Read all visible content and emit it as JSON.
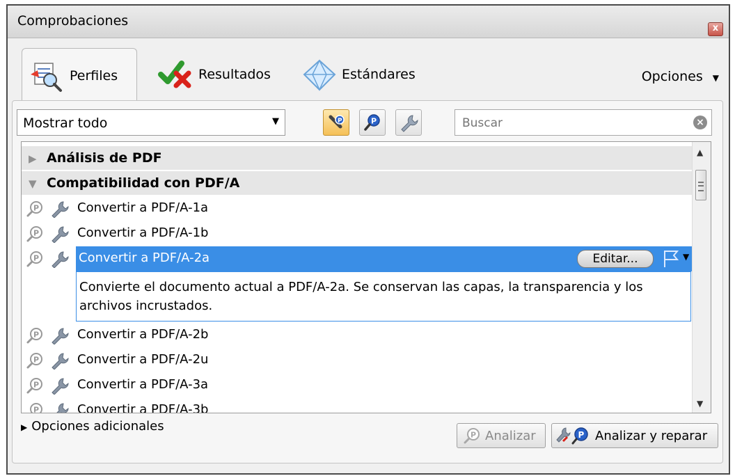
{
  "window": {
    "title": "Comprobaciones",
    "close_symbol": "x"
  },
  "tabs": [
    {
      "label": "Perfiles",
      "active": true,
      "icon": "profiles-icon"
    },
    {
      "label": "Resultados",
      "active": false,
      "icon": "results-icon"
    },
    {
      "label": "Estándares",
      "active": false,
      "icon": "standards-icon"
    }
  ],
  "options_menu": {
    "label": "Opciones",
    "arrow": "▼"
  },
  "filter": {
    "selected": "Mostrar todo",
    "arrow": "▼"
  },
  "toolbar_buttons": [
    "show-all-types-icon",
    "analyze-profile-icon",
    "fixup-icon"
  ],
  "search": {
    "placeholder": "Buscar",
    "clear_symbol": "×"
  },
  "groups": [
    {
      "label": "Análisis de PDF",
      "expanded": false,
      "tri": "▶"
    },
    {
      "label": "Compatibilidad con PDF/A",
      "expanded": true,
      "tri": "▼"
    }
  ],
  "items": [
    "Convertir a PDF/A-1a",
    "Convertir a PDF/A-1b",
    "Convertir a PDF/A-2a",
    "Convertir a PDF/A-2b",
    "Convertir a PDF/A-2u",
    "Convertir a PDF/A-3a",
    "Convertir a PDF/A-3b"
  ],
  "selected_item": {
    "label": "Convertir a PDF/A-2a",
    "edit_label": "Editar...",
    "description": "Convierte el documento actual a PDF/A-2a. Se conservan las capas, la transparencia y los archivos incrustados."
  },
  "footer": {
    "more_options": "Opciones adicionales",
    "more_tri": "▶",
    "analyze_label": "Analizar",
    "analyze_fix_label": "Analizar y reparar"
  },
  "colors": {
    "selection": "#3a8ee6",
    "group_bg": "#e6e6e6",
    "panel_bg": "#f0f0f0"
  }
}
